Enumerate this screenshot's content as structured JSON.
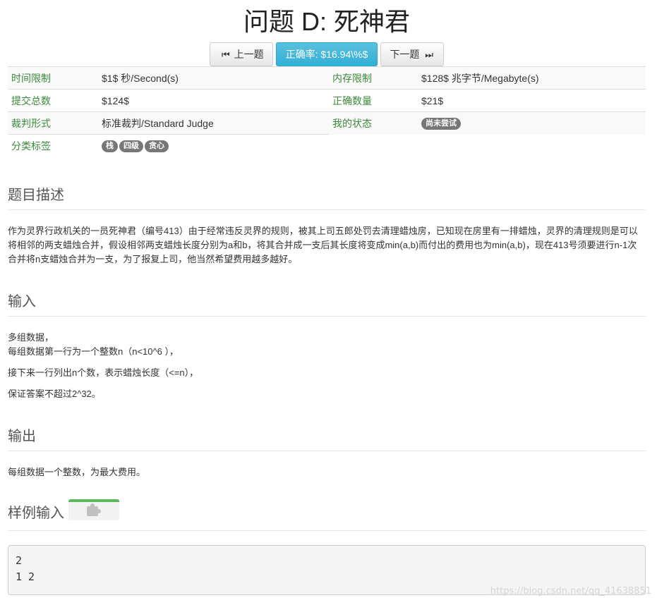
{
  "title": "问题 D: 死神君",
  "nav": {
    "prev_label": "上一题",
    "accuracy_label": "正确率: $16.94\\%$",
    "next_label": "下一题"
  },
  "meta": {
    "time_limit_label": "时间限制",
    "time_limit_value": "$1$ 秒/Second(s)",
    "memory_limit_label": "内存限制",
    "memory_limit_value": "$128$ 兆字节/Megabyte(s)",
    "submissions_label": "提交总数",
    "submissions_value": "$124$",
    "accepted_label": "正确数量",
    "accepted_value": "$21$",
    "judge_label": "裁判形式",
    "judge_value": "标准裁判/Standard Judge",
    "status_label": "我的状态",
    "status_value": "尚未尝试",
    "tags_label": "分类标签",
    "tags": [
      "栈",
      "四级",
      "贪心"
    ]
  },
  "description": {
    "heading": "题目描述",
    "text": "作为灵界行政机关的一员死神君（编号413）由于经常违反灵界的规则，被其上司五郎处罚去清理蜡烛房，已知现在房里有一排蜡烛，灵界的清理规则是可以将相邻的两支蜡烛合并，假设相邻两支蜡烛长度分别为a和b，将其合并成一支后其长度将变成min(a,b)而付出的费用也为min(a,b)，现在413号须要进行n-1次合并将n支蜡烛合并为一支，为了报复上司，他当然希望费用越多越好。"
  },
  "input": {
    "heading": "输入",
    "line1": "多组数据，",
    "line2": "每组数据第一行为一个整数n（n<10^6 ），",
    "line3": "接下来一行列出n个数，表示蜡烛长度（<=n），",
    "line4": "保证答案不超过2^32。"
  },
  "output": {
    "heading": "输出",
    "text": "每组数据一个整数，为最大费用。"
  },
  "sample_input": {
    "heading": "样例输入",
    "content": "2\n1 2"
  },
  "watermark": "https://blog.csdn.net/qq_41638851"
}
